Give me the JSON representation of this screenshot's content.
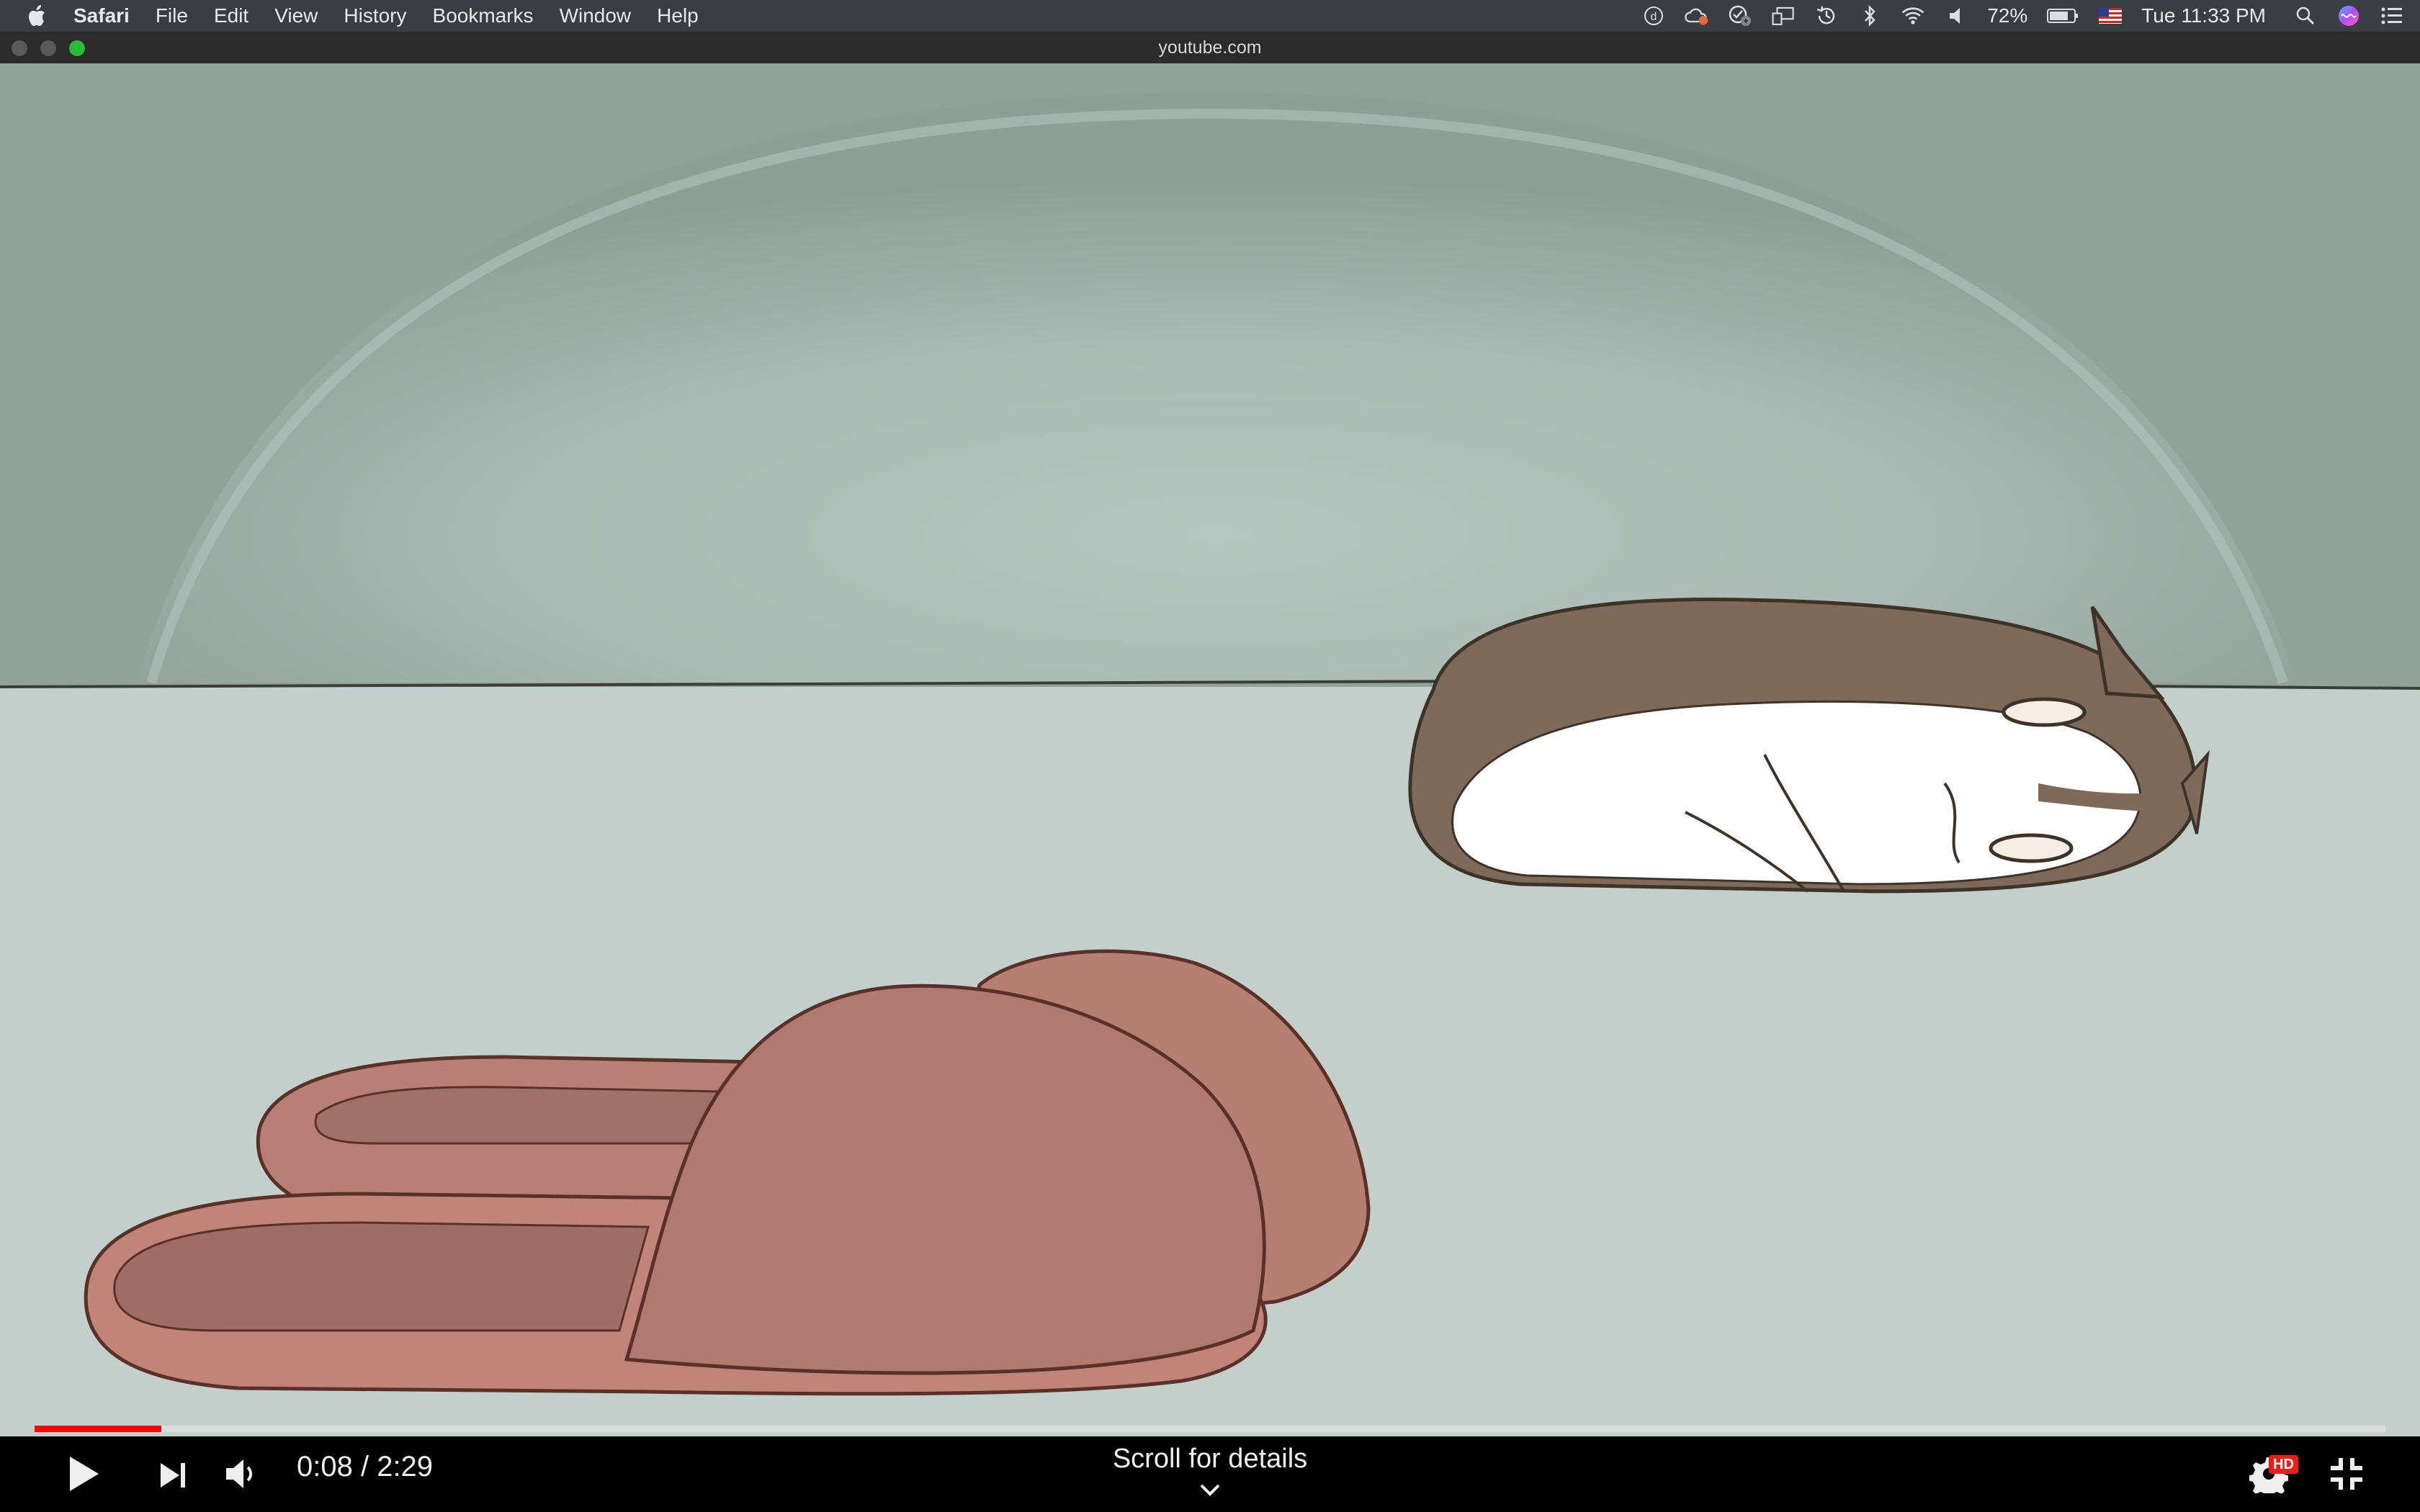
{
  "menubar": {
    "app_name": "Safari",
    "menus": [
      "File",
      "Edit",
      "View",
      "History",
      "Bookmarks",
      "Window",
      "Help"
    ],
    "status_icons": [
      "dashboard-icon",
      "cloud-sync-icon",
      "clock-check-icon",
      "airplay-icon",
      "time-machine-icon",
      "bluetooth-icon",
      "wifi-icon",
      "volume-icon"
    ],
    "battery_percent": "72%",
    "flag": "us-flag-icon",
    "clock": "Tue 11:33 PM"
  },
  "window": {
    "url": "youtube.com"
  },
  "player": {
    "current_time": "0:08",
    "duration": "2:29",
    "time_display": "0:08 / 2:29",
    "progress_fraction": 0.054,
    "scroll_hint": "Scroll for details",
    "quality_badge": "HD",
    "accent_color": "#ff0000"
  }
}
